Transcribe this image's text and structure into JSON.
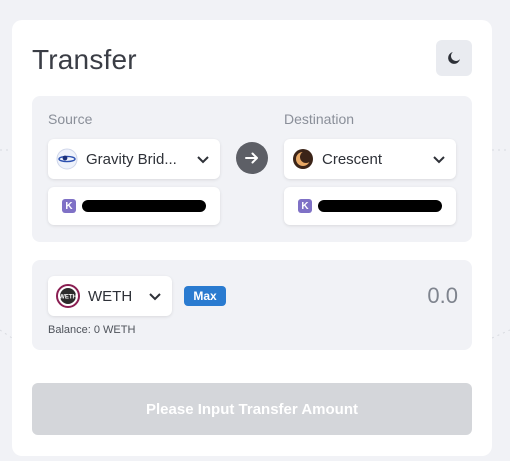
{
  "title": "Transfer",
  "theme_toggle": {
    "icon": "moon-icon"
  },
  "route": {
    "source": {
      "label": "Source",
      "chain": "Gravity Brid...",
      "chain_icon": "gravity-bridge-icon",
      "address_icon_letter": "K"
    },
    "destination": {
      "label": "Destination",
      "chain": "Crescent",
      "chain_icon": "crescent-icon",
      "address_icon_letter": "K"
    },
    "swap_icon": "arrow-right-icon"
  },
  "asset": {
    "token": "WETH",
    "token_icon": "weth-icon",
    "max_label": "Max",
    "amount_placeholder": "0.0",
    "balance_text": "Balance: 0 WETH"
  },
  "submit_label": "Please Input Transfer Amount",
  "colors": {
    "background": "#f1f2f6",
    "card": "#ffffff",
    "accent": "#2a7bd0",
    "arrow_button": "#5d5f66",
    "disabled_button": "#d4d6da"
  }
}
